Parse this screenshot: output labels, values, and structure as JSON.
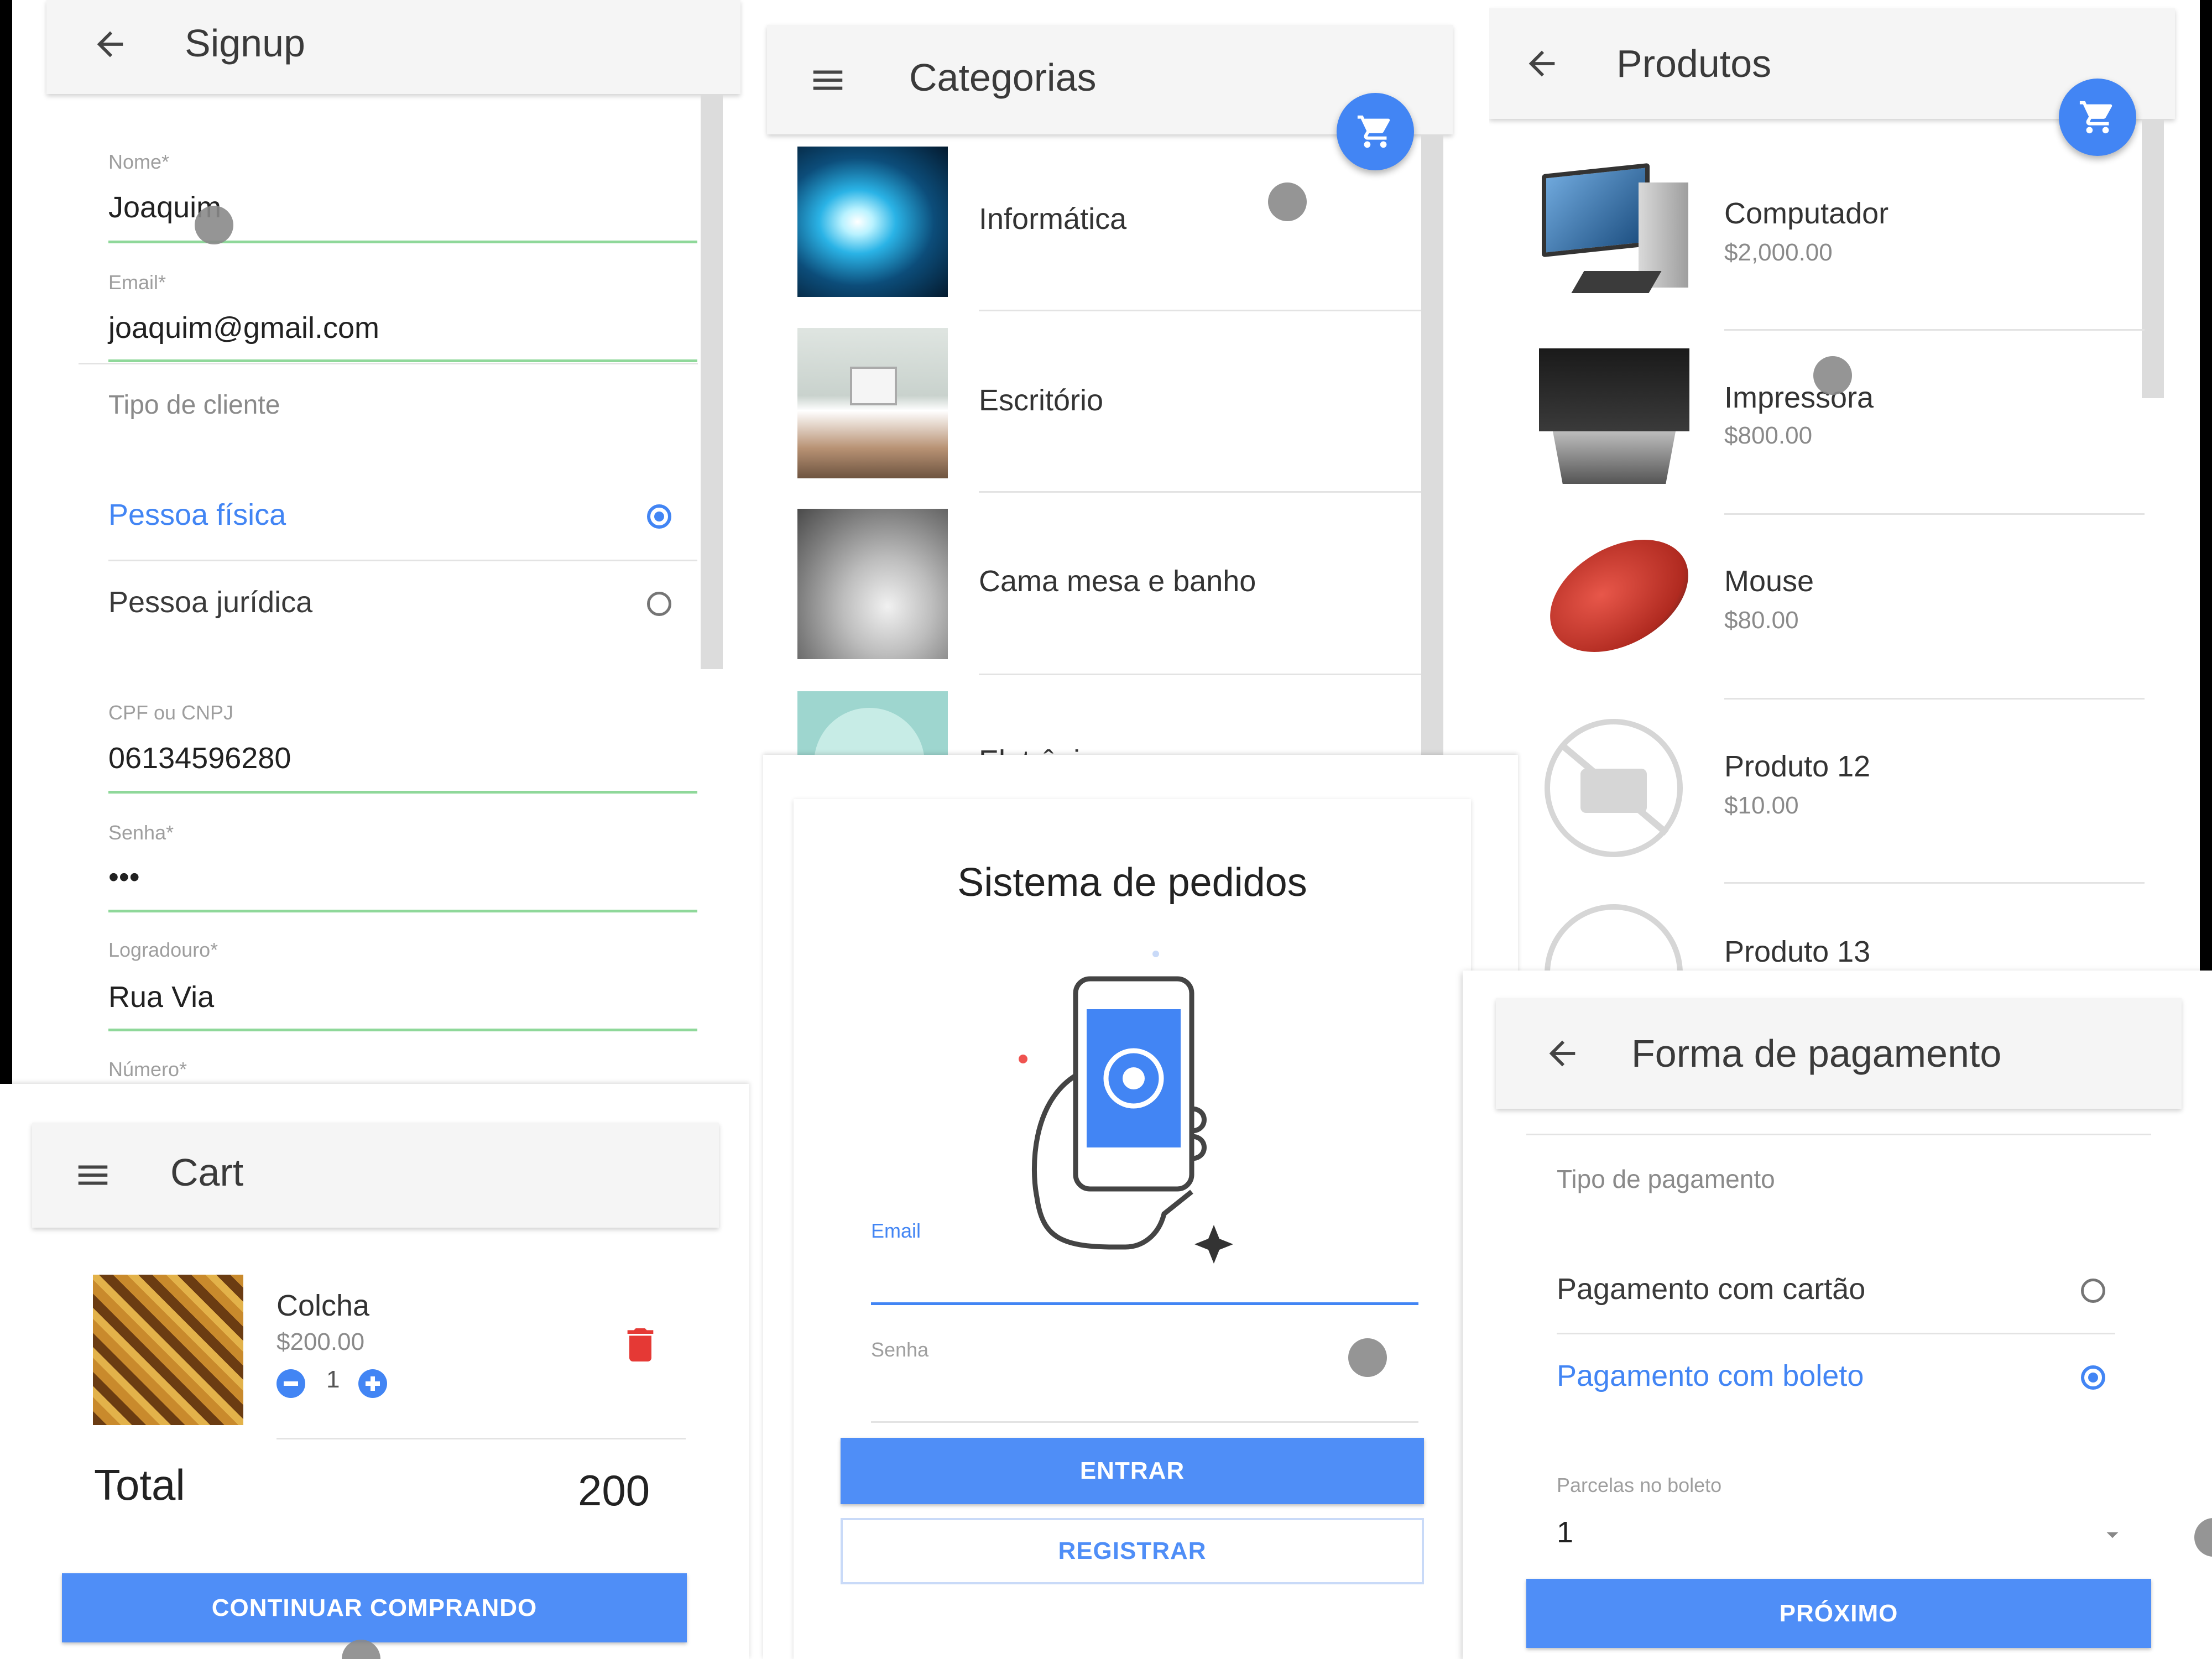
{
  "signup": {
    "title": "Signup",
    "fields": [
      {
        "label": "Nome*",
        "value": "Joaquim"
      },
      {
        "label": "Email*",
        "value": "joaquim@gmail.com"
      }
    ],
    "client_type_label": "Tipo de cliente",
    "client_options": [
      {
        "label": "Pessoa física",
        "selected": true
      },
      {
        "label": "Pessoa jurídica",
        "selected": false
      }
    ],
    "fields2": [
      {
        "label": "CPF ou CNPJ",
        "value": "06134596280"
      },
      {
        "label": "Senha*",
        "value": "•••"
      },
      {
        "label": "Logradouro*",
        "value": "Rua Via"
      }
    ],
    "numero_label": "Número*"
  },
  "categorias": {
    "title": "Categorias",
    "items": [
      "Informática",
      "Escritório",
      "Cama mesa e banho",
      "Eletrônicos"
    ]
  },
  "produtos": {
    "title": "Produtos",
    "items": [
      {
        "name": "Computador",
        "price": "$2,000.00"
      },
      {
        "name": "Impressora",
        "price": "$800.00"
      },
      {
        "name": "Mouse",
        "price": "$80.00"
      },
      {
        "name": "Produto 12",
        "price": "$10.00"
      },
      {
        "name": "Produto 13",
        "price": ""
      }
    ]
  },
  "cart": {
    "title": "Cart",
    "item": {
      "name": "Colcha",
      "price": "$200.00",
      "qty": "1"
    },
    "total_label": "Total",
    "total_value": "200",
    "continue_label": "CONTINUAR COMPRANDO"
  },
  "login": {
    "title": "Sistema de pedidos",
    "email_label": "Email",
    "password_label": "Senha",
    "enter_label": "ENTRAR",
    "register_label": "REGISTRAR"
  },
  "pagamento": {
    "title": "Forma de pagamento",
    "type_label": "Tipo de pagamento",
    "options": [
      {
        "label": "Pagamento com cartão",
        "selected": false
      },
      {
        "label": "Pagamento com boleto",
        "selected": true
      }
    ],
    "installments_label": "Parcelas no boleto",
    "installments_value": "1",
    "next_label": "PRÓXIMO"
  },
  "colors": {
    "accent": "#4285f4",
    "underline": "#8fd89a",
    "delete": "#e53935"
  }
}
